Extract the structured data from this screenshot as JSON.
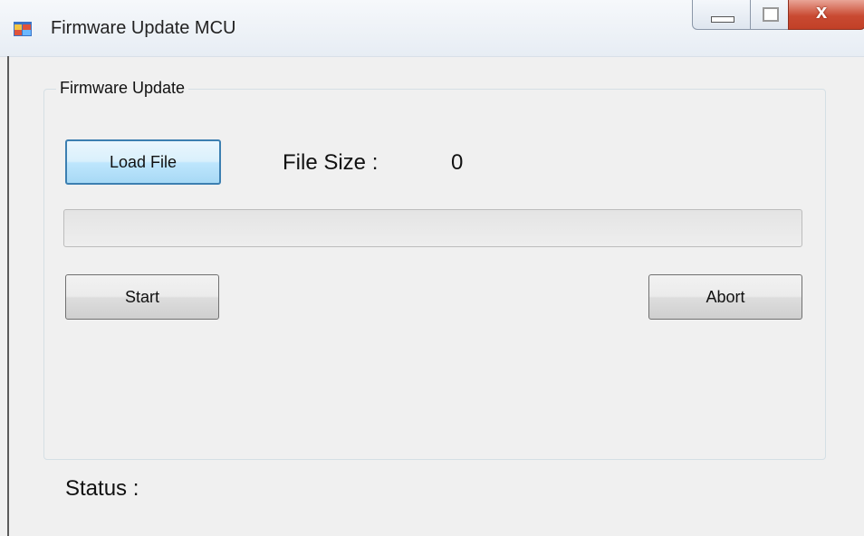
{
  "window": {
    "title": "Firmware Update MCU",
    "icon": "windows-form-icon",
    "controls": [
      "minimize",
      "maximize",
      "close"
    ],
    "close_glyph": "x"
  },
  "group": {
    "title": "Firmware Update"
  },
  "load_button_label": "Load File",
  "file_size": {
    "label": "File Size :",
    "value": "0"
  },
  "progress": {
    "value": 0
  },
  "start_button_label": "Start",
  "abort_button_label": "Abort",
  "status": {
    "label": "Status :"
  },
  "colors": {
    "accent_button_border": "#3c7fb1",
    "close_button": "#c94a32",
    "progress_fill": "#06b025"
  }
}
